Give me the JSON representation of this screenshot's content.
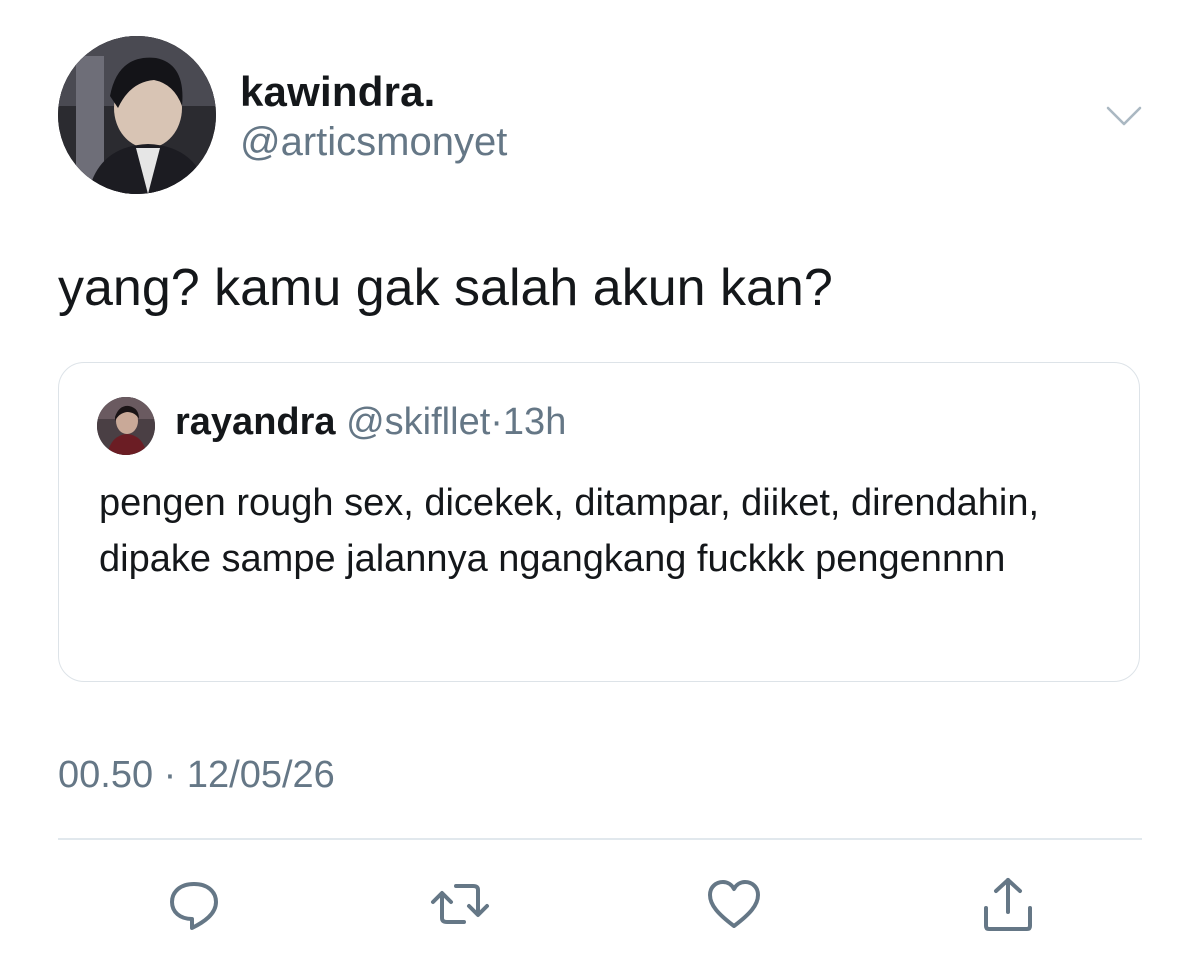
{
  "tweet": {
    "display_name": "kawindra.",
    "handle": "@articsmonyet",
    "text": "yang? kamu gak salah akun kan?",
    "timestamp": "00.50 · 12/05/26"
  },
  "quoted_tweet": {
    "display_name": "rayandra",
    "handle": "@skifllet",
    "separator": "·",
    "time": "13h",
    "text": "pengen rough sex, dicekek, ditampar, diiket, direndahin, dipake sampe jalannya ngangkang fuckkk pengennnn"
  },
  "actions": [
    "reply-icon",
    "retweet-icon",
    "like-icon",
    "share-icon"
  ],
  "colors": {
    "text_primary": "#14171a",
    "text_secondary": "#657786",
    "border": "#dde3e8",
    "icon": "#657786"
  }
}
